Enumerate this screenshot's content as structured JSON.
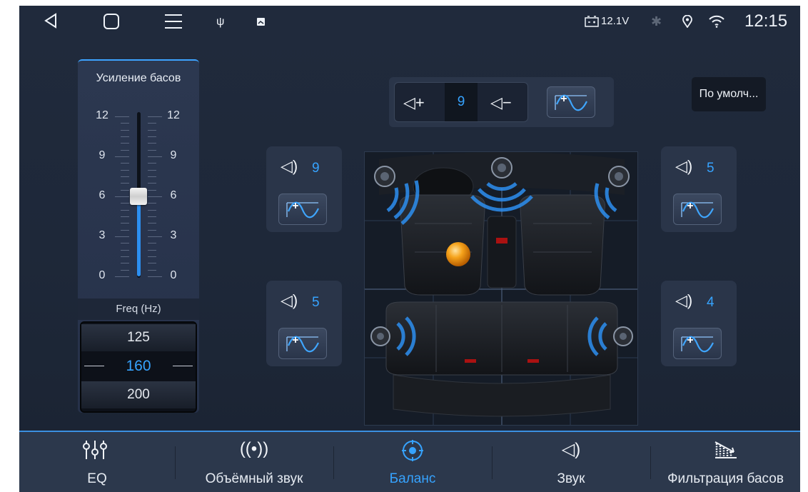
{
  "status_bar": {
    "voltage": "12.1V",
    "time": "12:15",
    "icons": [
      "back-icon",
      "home-icon",
      "menu-icon",
      "usb-icon",
      "image-icon",
      "battery-icon",
      "bluetooth-icon",
      "location-icon",
      "wifi-icon"
    ]
  },
  "bass_panel": {
    "title": "Усиление басов",
    "scale": [
      "12",
      "9",
      "6",
      "3",
      "0"
    ],
    "level": 6,
    "max": 12,
    "freq_header": "Freq (Hz)",
    "freq_prev": "125",
    "freq_selected": "160",
    "freq_next": "200"
  },
  "top_control": {
    "volume_value": "9"
  },
  "default_button": "По умолч...",
  "speakers": {
    "front_left": "9",
    "front_right": "5",
    "rear_left": "5",
    "rear_right": "4"
  },
  "nav": {
    "items": [
      {
        "label": "EQ",
        "icon": "eq-sliders-icon"
      },
      {
        "label": "Объёмный звук",
        "icon": "surround-icon"
      },
      {
        "label": "Баланс",
        "icon": "balance-target-icon"
      },
      {
        "label": "Звук",
        "icon": "speaker-icon"
      },
      {
        "label": "Фильтрация басов",
        "icon": "bass-filter-icon"
      }
    ],
    "active_index": 2
  },
  "colors": {
    "accent": "#36a3ff",
    "panel": "#2a3549",
    "background": "#1e2839"
  }
}
